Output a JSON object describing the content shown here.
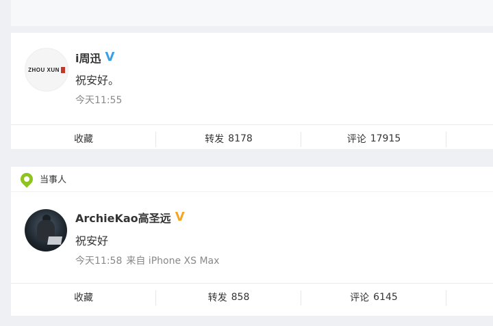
{
  "posts": [
    {
      "username": "i周迅",
      "verified_badge": "V",
      "verified_color": "#3aa0e8",
      "avatar_logo": "ZHOU XUN",
      "content": "祝安好。",
      "time": "今天11:55",
      "source": "",
      "actions": {
        "favorite_label": "收藏",
        "repost_label": "转发",
        "repost_count": "8178",
        "comment_label": "评论",
        "comment_count": "17915"
      }
    },
    {
      "tag_label": "当事人",
      "username": "ArchieKao高圣远",
      "verified_badge": "V",
      "verified_color": "#f5a623",
      "content": "祝安好",
      "time": "今天11:58",
      "source": "来自 iPhone XS Max",
      "actions": {
        "favorite_label": "收藏",
        "repost_label": "转发",
        "repost_count": "858",
        "comment_label": "评论",
        "comment_count": "6145"
      }
    }
  ]
}
